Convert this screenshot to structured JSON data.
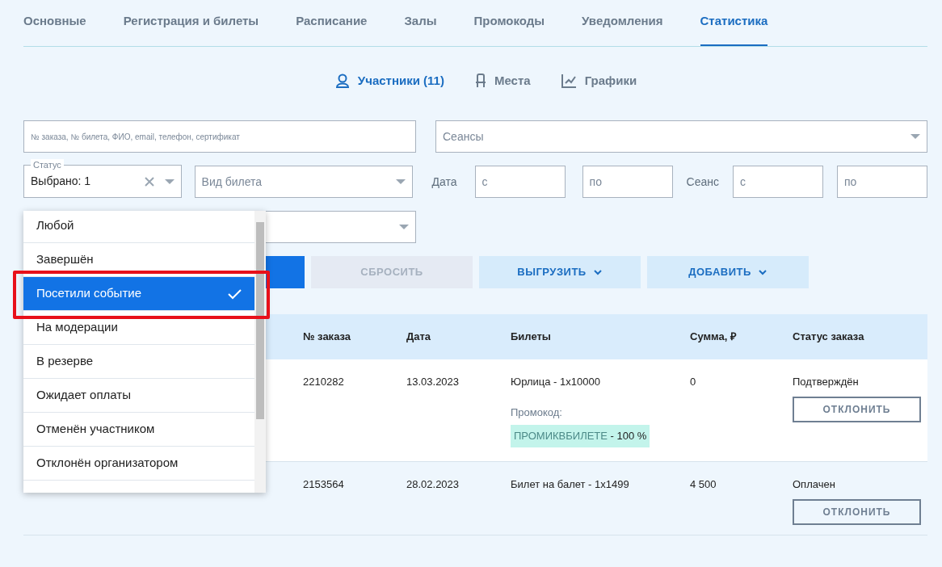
{
  "tabs": [
    {
      "label": "Основные",
      "selected": false
    },
    {
      "label": "Регистрация и билеты",
      "selected": false
    },
    {
      "label": "Расписание",
      "selected": false
    },
    {
      "label": "Залы",
      "selected": false
    },
    {
      "label": "Промокоды",
      "selected": false
    },
    {
      "label": "Уведомления",
      "selected": false
    },
    {
      "label": "Статистика",
      "selected": true
    }
  ],
  "subtabs": [
    {
      "label": "Участники (11)",
      "kind": "person",
      "selected": true
    },
    {
      "label": "Места",
      "kind": "chair",
      "selected": false
    },
    {
      "label": "Графики",
      "kind": "chart",
      "selected": false
    }
  ],
  "filters": {
    "search": {
      "placeholder": "№ заказа, № билета, ФИО, email, телефон, сертификат"
    },
    "sessions": {
      "placeholder": "Сеансы"
    },
    "status": {
      "label": "Статус",
      "value": "Выбрано: 1"
    },
    "ticket_type": {
      "placeholder": "Вид билета"
    },
    "date": {
      "label": "Дата",
      "from_placeholder": "с",
      "to_placeholder": "по"
    },
    "session": {
      "label": "Сеанс",
      "from_placeholder": "с",
      "to_placeholder": "по"
    }
  },
  "actions": [
    {
      "kind": "primary"
    },
    {
      "kind": "reset",
      "label": "СБРОСИТЬ"
    },
    {
      "kind": "menu",
      "label": "ВЫГРУЗИТЬ"
    },
    {
      "kind": "menu",
      "label": "ДОБАВИТЬ"
    }
  ],
  "status_dropdown": {
    "options": [
      {
        "label": "Любой",
        "selected": false,
        "annotated": false
      },
      {
        "label": "Завершён",
        "selected": false,
        "annotated": false
      },
      {
        "label": "Посетили событие",
        "selected": true,
        "annotated": true
      },
      {
        "label": "На модерации",
        "selected": false,
        "annotated": false
      },
      {
        "label": "В резерве",
        "selected": false,
        "annotated": false
      },
      {
        "label": "Ожидает оплаты",
        "selected": false,
        "annotated": false
      },
      {
        "label": "Отменён участником",
        "selected": false,
        "annotated": false
      },
      {
        "label": "Отклонён организатором",
        "selected": false,
        "annotated": false
      }
    ]
  },
  "table": {
    "columns": [
      "№ заказа",
      "Дата",
      "Билеты",
      "Сумма, ₽",
      "Статус заказа"
    ],
    "rows": [
      {
        "order": "2210282",
        "date": "13.03.2023",
        "tickets": "Юрлица - 1x10000",
        "promo": {
          "label": "Промокод:",
          "code": "ПРОМИКВБИЛЕТЕ",
          "discount": " - 100 %"
        },
        "sum": "0",
        "status": "Подтверждён",
        "action": "ОТКЛОНИТЬ"
      },
      {
        "order": "2153564",
        "date": "28.02.2023",
        "tickets": "Билет на балет - 1x1499",
        "sum": "4 500",
        "status": "Оплачен",
        "action": "ОТКЛОНИТЬ"
      }
    ]
  }
}
